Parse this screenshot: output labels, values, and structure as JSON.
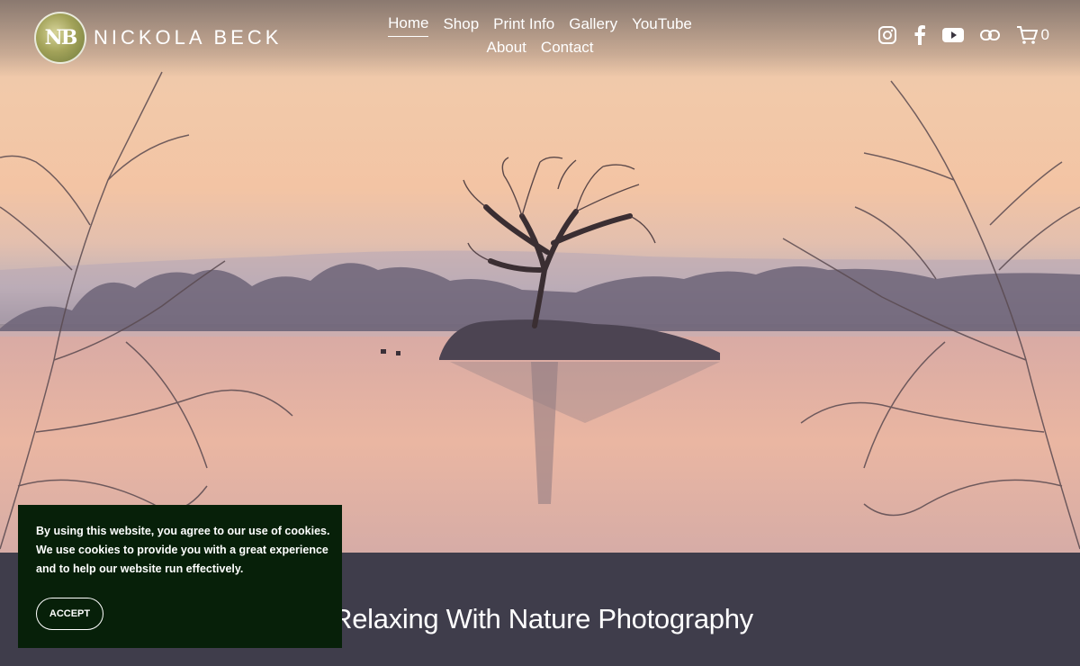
{
  "brand": {
    "name": "NICKOLA BECK",
    "logo_icon": "nb-monogram-logo"
  },
  "nav": {
    "row1": [
      "Home",
      "Shop",
      "Print Info",
      "Gallery",
      "YouTube"
    ],
    "row2": [
      "About",
      "Contact"
    ],
    "active": "Home"
  },
  "social": {
    "icons": [
      "instagram-icon",
      "facebook-icon",
      "youtube-icon",
      "link-icon",
      "cart-icon"
    ],
    "cart_count": "0"
  },
  "hero": {
    "scene": "sunrise-lake-with-island-tree"
  },
  "section": {
    "title": "Relaxing With Nature Photography"
  },
  "cookie": {
    "message": "By using this website, you agree to our use of cookies. We use cookies to provide you with a great experience and to help our website run effectively.",
    "accept_label": "ACCEPT"
  },
  "colors": {
    "band": "#3f3d4b",
    "cookie_bg": "#072009",
    "text": "#ffffff"
  }
}
